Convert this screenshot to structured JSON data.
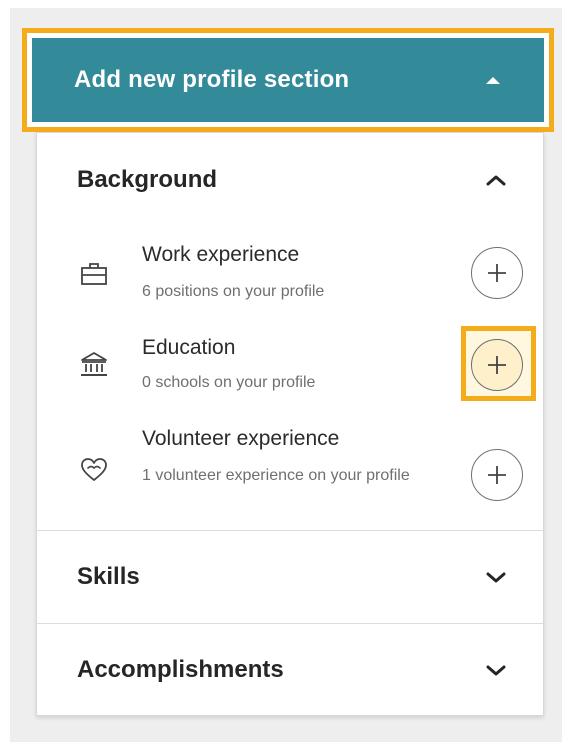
{
  "header": {
    "title": "Add new profile section"
  },
  "sections": {
    "background": {
      "title": "Background",
      "items": [
        {
          "title": "Work experience",
          "subtitle": "6 positions on your profile",
          "icon": "briefcase-icon"
        },
        {
          "title": "Education",
          "subtitle": "0 schools on your profile",
          "icon": "school-icon"
        },
        {
          "title": "Volunteer experience",
          "subtitle": "1 volunteer experience on your profile",
          "icon": "heart-icon"
        }
      ]
    },
    "skills": {
      "title": "Skills"
    },
    "accomplishments": {
      "title": "Accomplishments"
    }
  },
  "colors": {
    "header_bg": "#338b99",
    "highlight": "#f5ac1a"
  }
}
